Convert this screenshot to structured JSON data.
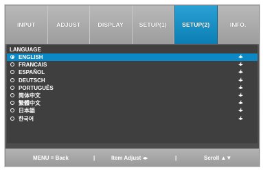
{
  "tabs": [
    {
      "label": "INPUT"
    },
    {
      "label": "ADJUST"
    },
    {
      "label": "DISPLAY"
    },
    {
      "label": "SETUP(1)"
    },
    {
      "label": "SETUP(2)",
      "active": true
    },
    {
      "label": "INFO."
    }
  ],
  "section": {
    "title": "LANGUAGE"
  },
  "languages": [
    {
      "label": "ENGLISH",
      "selected": true
    },
    {
      "label": "FRANCAIS"
    },
    {
      "label": "ESPAÑOL"
    },
    {
      "label": "DEUTSCH"
    },
    {
      "label": "PORTUGUÊS"
    },
    {
      "label": "简体中文"
    },
    {
      "label": "繁體中文"
    },
    {
      "label": "日本語"
    },
    {
      "label": "한국어"
    }
  ],
  "row_arrow_icon": "◂/▸",
  "footer": {
    "menu": "MENU = Back",
    "sep1": "|",
    "item_adjust": "Item Adjust ◂▸",
    "sep2": "|",
    "scroll": "Scroll ▲▼"
  },
  "colors": {
    "accent": "#0c89c4",
    "tab_bar": "#a8a8a8",
    "panel": "#3f3f3f"
  }
}
